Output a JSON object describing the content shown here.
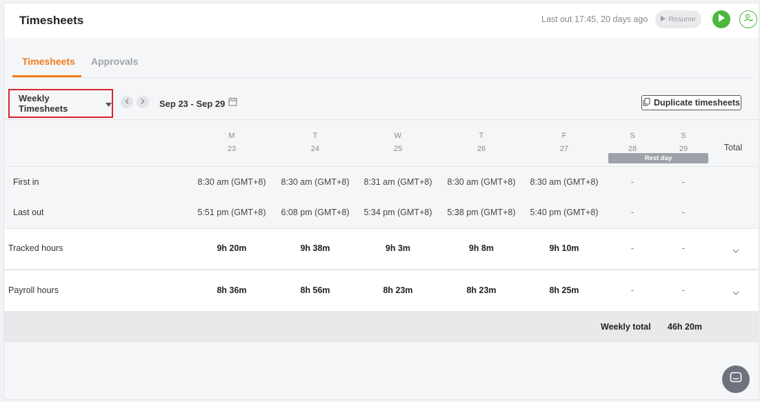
{
  "header": {
    "title": "Timesheets",
    "last_out": "Last out 17:45, 20 days ago",
    "resume_label": "Resume"
  },
  "tabs": [
    {
      "label": "Timesheets",
      "active": true
    },
    {
      "label": "Approvals",
      "active": false
    }
  ],
  "toolbar": {
    "view_select": "Weekly Timesheets",
    "date_range": "Sep 23 - Sep 29",
    "duplicate_label": "Duplicate timesheets"
  },
  "days": [
    {
      "letter": "M",
      "num": "23"
    },
    {
      "letter": "T",
      "num": "24"
    },
    {
      "letter": "W",
      "num": "25"
    },
    {
      "letter": "T",
      "num": "26"
    },
    {
      "letter": "F",
      "num": "27"
    },
    {
      "letter": "S",
      "num": "28"
    },
    {
      "letter": "S",
      "num": "29"
    }
  ],
  "rest_day_label": "Rest day",
  "total_label": "Total",
  "rows": {
    "first_in": {
      "label": "First in",
      "values": [
        "8:30 am (GMT+8)",
        "8:30 am (GMT+8)",
        "8:31 am (GMT+8)",
        "8:30 am (GMT+8)",
        "8:30 am (GMT+8)",
        "-",
        "-"
      ]
    },
    "last_out": {
      "label": "Last out",
      "values": [
        "5:51 pm (GMT+8)",
        "6:08 pm (GMT+8)",
        "5:34 pm (GMT+8)",
        "5:38 pm (GMT+8)",
        "5:40 pm (GMT+8)",
        "-",
        "-"
      ]
    },
    "tracked": {
      "label": "Tracked hours",
      "values": [
        "9h 20m",
        "9h 38m",
        "9h 3m",
        "9h 8m",
        "9h 10m",
        "-",
        "-"
      ]
    },
    "payroll": {
      "label": "Payroll hours",
      "values": [
        "8h 36m",
        "8h 56m",
        "8h 23m",
        "8h 23m",
        "8h 25m",
        "-",
        "-"
      ]
    }
  },
  "weekly_total": {
    "label": "Weekly total",
    "value": "46h 20m"
  },
  "colors": {
    "accent": "#f27d1d",
    "play_green": "#4cb63d",
    "highlight_red": "#d9252a"
  }
}
